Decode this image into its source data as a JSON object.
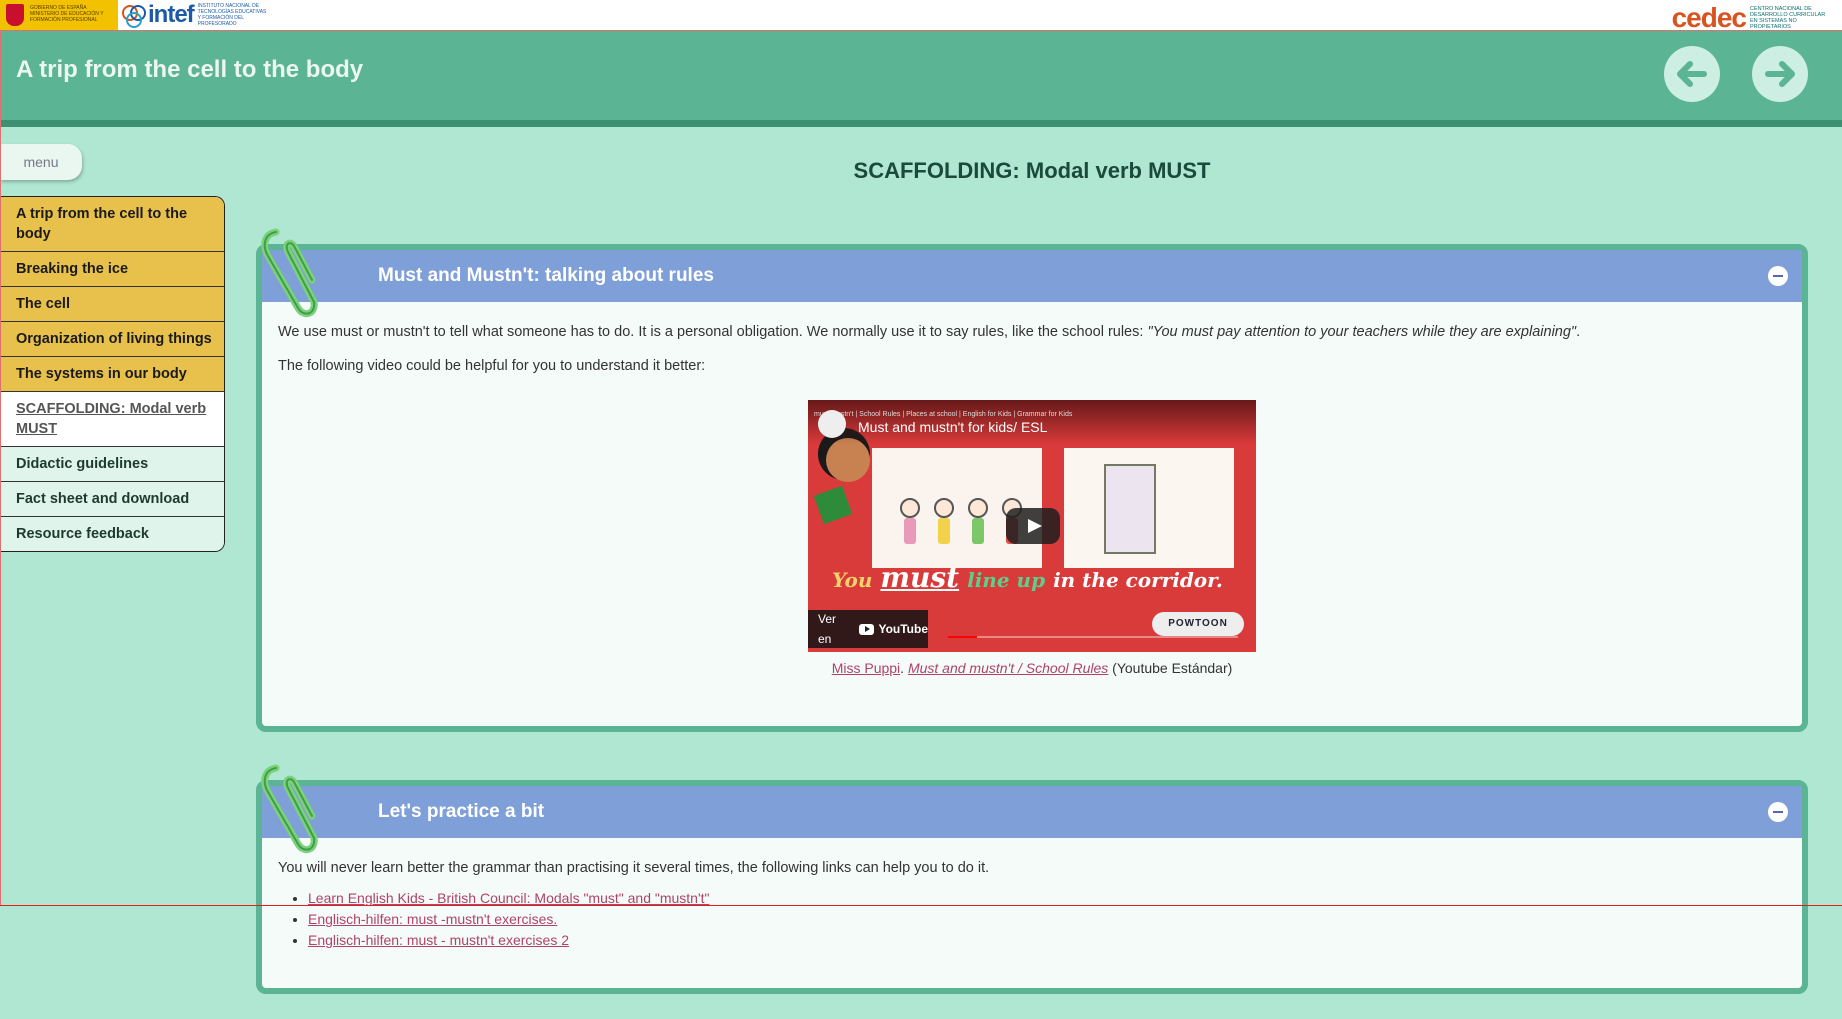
{
  "branding": {
    "gov_logo_text": "GOBIERNO DE ESPAÑA  MINISTERIO DE EDUCACIÓN Y FORMACIÓN PROFESIONAL",
    "intef_name": "intef",
    "intef_subtitle": "INSTITUTO NACIONAL DE TECNOLOGÍAS EDUCATIVAS Y FORMACIÓN DEL PROFESORADO",
    "cedec_name": "cedec",
    "cedec_subtitle": "CENTRO NACIONAL DE DESARROLLO CURRICULAR EN SISTEMAS NO PROPIETARIOS"
  },
  "header": {
    "title": "A trip from the cell to the body",
    "prev_icon": "arrow-left-icon",
    "next_icon": "arrow-right-icon"
  },
  "menu_toggle": "menu",
  "sidebar": {
    "items": [
      {
        "label": "A trip from the cell to the body",
        "style": "yellow"
      },
      {
        "label": "Breaking the ice",
        "style": "yellow"
      },
      {
        "label": "The cell",
        "style": "yellow"
      },
      {
        "label": "Organization of living things",
        "style": "yellow"
      },
      {
        "label": "The systems in our body",
        "style": "yellow"
      },
      {
        "label": "SCAFFOLDING: Modal verb MUST",
        "style": "current"
      },
      {
        "label": "Didactic guidelines",
        "style": "light"
      },
      {
        "label": "Fact sheet and download",
        "style": "light"
      },
      {
        "label": "Resource feedback",
        "style": "light"
      }
    ]
  },
  "page_title": "SCAFFOLDING: Modal verb MUST",
  "box1": {
    "title": "Must and Mustn't: talking about rules",
    "para1_pre": "We use must or mustn't to tell what someone has to do. It is a personal obligation. We normally use it to say rules, like the school rules: ",
    "para1_quote": "\"You must pay attention to your teachers while they are explaining\"",
    "para1_post": ".",
    "para2": "The following video could be helpful for you to understand it better:",
    "video": {
      "top_row": "must/mustn't  |  School Rules  |  Places at school  |  English for Kids  |  Grammar for Kids",
      "title": "Must and mustn't for kids/ ESL",
      "caption_you": "You",
      "caption_must": "must",
      "caption_lineup": "line up",
      "caption_rest": "in the corridor.",
      "ver_en": "Ver en",
      "youtube": "YouTube",
      "powtoon": "POWTOON",
      "progress": 0.1
    },
    "caption_author": "Miss Puppi",
    "caption_sep": ". ",
    "caption_link": "Must and mustn't / School Rules",
    "caption_tail": " (Youtube Estándar)"
  },
  "box2": {
    "title": "Let's practice a bit",
    "intro": "You will never learn better the grammar than practising it several times, the following links can help you to do it.",
    "links": [
      "Learn English Kids - British Council: Modals \"must\" and \"mustn't\"",
      "Englisch-hilfen: must -mustn't exercises.",
      "Englisch-hilfen: must - mustn't exercises 2"
    ]
  },
  "colors": {
    "background": "#b0e7d3",
    "header": "#5bb494",
    "sidebar_yellow": "#e8c04c",
    "box_head": "#7f9fd8",
    "link": "#b0436a"
  }
}
